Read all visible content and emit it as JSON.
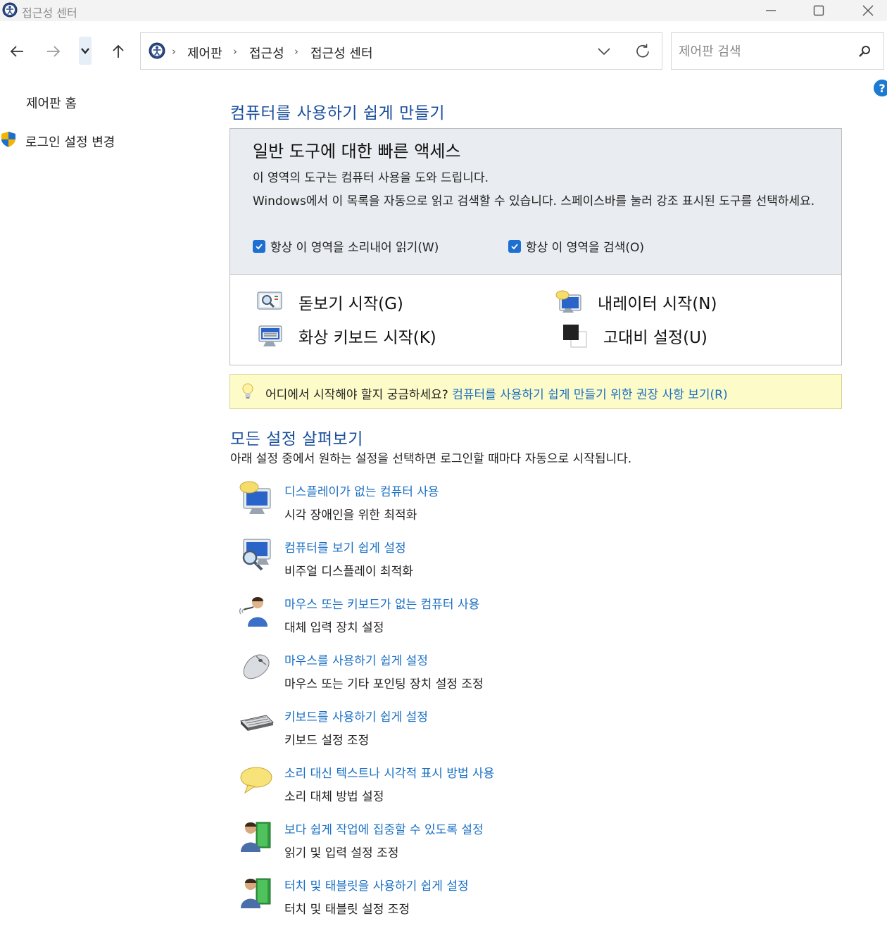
{
  "window": {
    "title": "접근성 센터",
    "icon": "control-panel-icon",
    "buttons": [
      "minimize",
      "maximize",
      "close"
    ]
  },
  "nav": {
    "breadcrumb": [
      "제어판",
      "접근성",
      "접근성 센터"
    ],
    "search_placeholder": "제어판 검색",
    "help_label": "?"
  },
  "sidebar": {
    "home_label": "제어판 홈",
    "signin_label": "로그인 설정 변경"
  },
  "main": {
    "heading": "컴퓨터를 사용하기 쉽게 만들기",
    "quick_access": {
      "title": "일반 도구에 대한 빠른 액세스",
      "desc1": "이 영역의 도구는 컴퓨터 사용을 도와 드립니다.",
      "desc2": "Windows에서 이 목록을 자동으로 읽고 검색할 수 있습니다. 스페이스바를 눌러 강조 표시된 도구를 선택하세요.",
      "checkbox_read": "항상 이 영역을 소리내어 읽기(W)",
      "checkbox_scan": "항상 이 영역을 검색(O)",
      "checkbox_read_checked": true,
      "checkbox_scan_checked": true,
      "tools": {
        "magnifier": "돋보기 시작(G)",
        "narrator": "내레이터 시작(N)",
        "osk": "화상 키보드 시작(K)",
        "contrast": "고대비 설정(U)"
      }
    },
    "tip": {
      "text": "어디에서 시작해야 할지 궁금하세요?",
      "link": "컴퓨터를 사용하기 쉽게 만들기 위한 권장 사항 보기(R)"
    },
    "all_settings": {
      "heading": "모든 설정 살펴보기",
      "subtitle": "아래 설정 중에서 원하는 설정을 선택하면 로그인할 때마다 자동으로 시작됩니다.",
      "items": [
        {
          "link": "디스플레이가 없는 컴퓨터 사용",
          "desc": "시각 장애인을 위한 최적화",
          "icon": "narrator-monitor-icon"
        },
        {
          "link": "컴퓨터를 보기 쉽게 설정",
          "desc": "비주얼 디스플레이 최적화",
          "icon": "magnifier-monitor-icon"
        },
        {
          "link": "마우스 또는 키보드가 없는 컴퓨터 사용",
          "desc": "대체 입력 장치 설정",
          "icon": "speech-user-icon"
        },
        {
          "link": "마우스를 사용하기 쉽게 설정",
          "desc": "마우스 또는 기타 포인팅 장치 설정 조정",
          "icon": "mouse-icon"
        },
        {
          "link": "키보드를 사용하기 쉽게 설정",
          "desc": "키보드 설정 조정",
          "icon": "keyboard-icon"
        },
        {
          "link": "소리 대신 텍스트나 시각적 표시 방법 사용",
          "desc": "소리 대체 방법 설정",
          "icon": "speech-bubble-icon"
        },
        {
          "link": "보다 쉽게 작업에 집중할 수 있도록 설정",
          "desc": "읽기 및 입력 설정 조정",
          "icon": "user-book-icon"
        },
        {
          "link": "터치 및 태블릿을 사용하기 쉽게 설정",
          "desc": "터치 및 태블릿 설정 조정",
          "icon": "user-book-icon"
        }
      ]
    }
  },
  "colors": {
    "link": "#1a6fc4",
    "heading": "#1a4f9c",
    "panel_bg": "#e9ecf0",
    "tip_bg": "#fdfbc8",
    "checkbox": "#1d6fd1"
  }
}
